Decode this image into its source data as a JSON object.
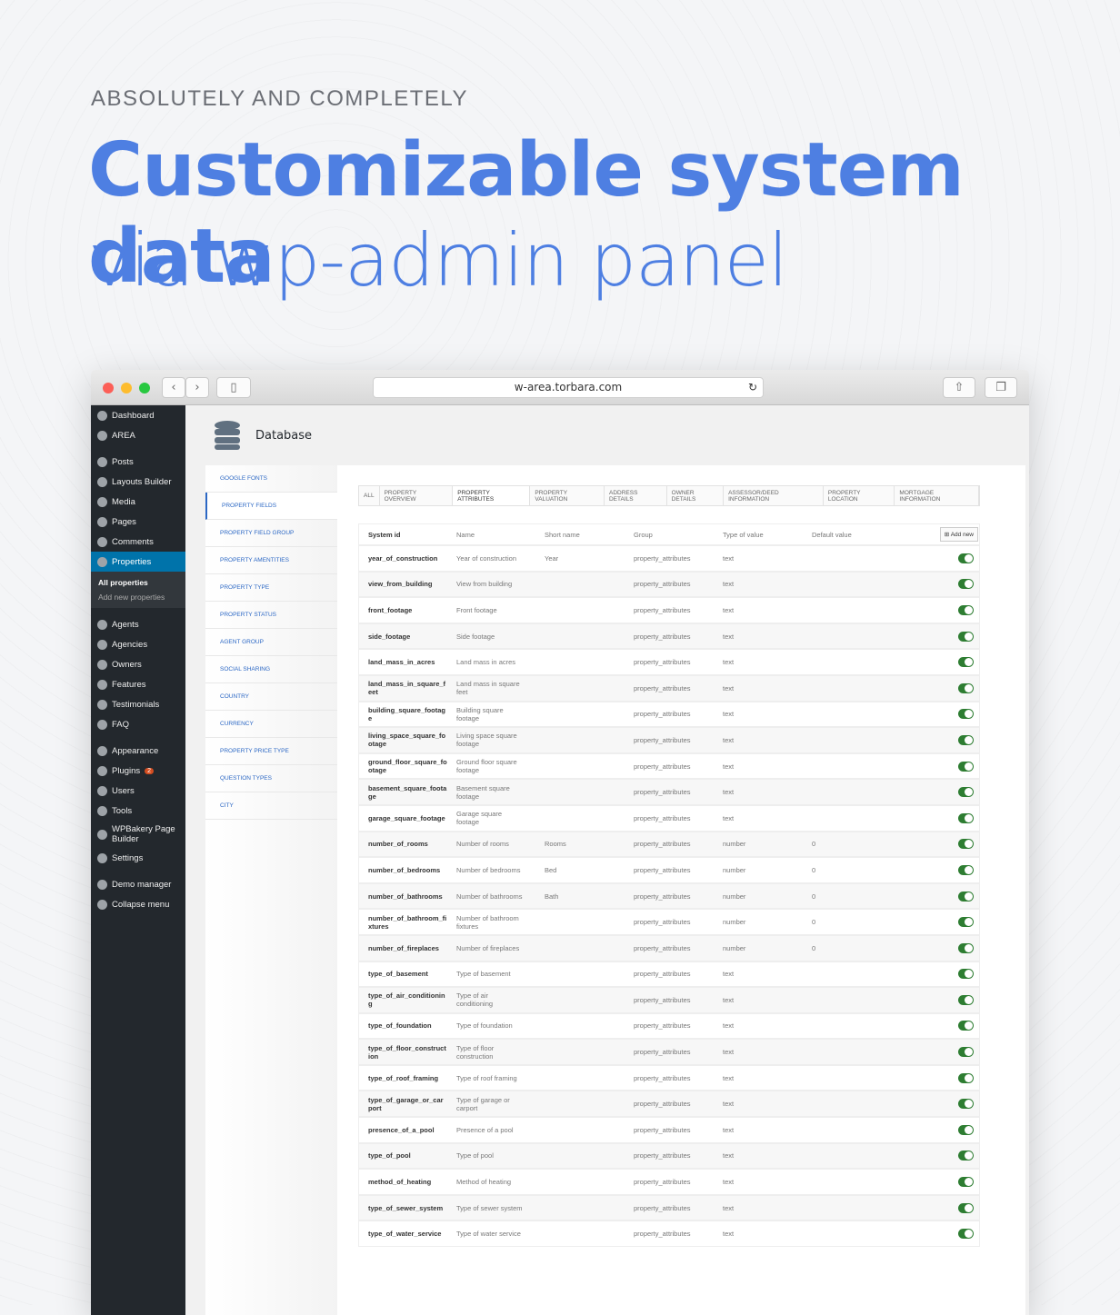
{
  "hero": {
    "kicker": "ABSOLUTELY AND COMPLETELY",
    "title": "Customizable system data",
    "subtitle": "via wp-admin panel",
    "accent": "#4e7fe2"
  },
  "browser": {
    "url": "w-area.torbara.com"
  },
  "sidebar": {
    "items": [
      {
        "label": "Dashboard"
      },
      {
        "label": "AREA"
      },
      {
        "label": "Posts"
      },
      {
        "label": "Layouts Builder"
      },
      {
        "label": "Media"
      },
      {
        "label": "Pages"
      },
      {
        "label": "Comments"
      },
      {
        "label": "Properties",
        "active": true
      },
      {
        "label": "Agents"
      },
      {
        "label": "Agencies"
      },
      {
        "label": "Owners"
      },
      {
        "label": "Features"
      },
      {
        "label": "Testimonials"
      },
      {
        "label": "FAQ"
      },
      {
        "label": "Appearance"
      },
      {
        "label": "Plugins",
        "badge": "2"
      },
      {
        "label": "Users"
      },
      {
        "label": "Tools"
      },
      {
        "label": "WPBakery Page Builder"
      },
      {
        "label": "Settings"
      },
      {
        "label": "Demo manager"
      },
      {
        "label": "Collapse menu"
      }
    ],
    "submenu": [
      "All properties",
      "Add new properties"
    ]
  },
  "page": {
    "title": "Database"
  },
  "left_tabs": [
    "GOOGLE FONTS",
    "PROPERTY FIELDS",
    "PROPERTY FIELD GROUP",
    "PROPERTY AMENTITIES",
    "PROPERTY TYPE",
    "PROPERTY STATUS",
    "AGENT GROUP",
    "SOCIAL SHARING",
    "COUNTRY",
    "CURRENCY",
    "PROPERTY PRICE TYPE",
    "QUESTION TYPES",
    "CITY"
  ],
  "left_active": 1,
  "group_tabs": [
    "ALL",
    "PROPERTY OVERVIEW",
    "PROPERTY ATTRIBUTES",
    "PROPERTY VALUATION",
    "ADDRESS DETAILS",
    "OWNER DETAILS",
    "ASSESSOR/DEED INFORMATION",
    "PROPERTY LOCATION",
    "MORTGAGE INFORMATION"
  ],
  "group_active": 2,
  "table": {
    "headers": [
      "System id",
      "Name",
      "Short name",
      "Group",
      "Type of value",
      "Default value"
    ],
    "add_label": "Add new",
    "toggle_color": "#2e7d32",
    "rows": [
      [
        "year_of_construction",
        "Year of construction",
        "Year",
        "property_attributes",
        "text",
        ""
      ],
      [
        "view_from_building",
        "View from building",
        "",
        "property_attributes",
        "text",
        ""
      ],
      [
        "front_footage",
        "Front footage",
        "",
        "property_attributes",
        "text",
        ""
      ],
      [
        "side_footage",
        "Side footage",
        "",
        "property_attributes",
        "text",
        ""
      ],
      [
        "land_mass_in_acres",
        "Land mass in acres",
        "",
        "property_attributes",
        "text",
        ""
      ],
      [
        "land_mass_in_square_feet",
        "Land mass in square feet",
        "",
        "property_attributes",
        "text",
        ""
      ],
      [
        "building_square_footage",
        "Building square footage",
        "",
        "property_attributes",
        "text",
        ""
      ],
      [
        "living_space_square_footage",
        "Living space square footage",
        "",
        "property_attributes",
        "text",
        ""
      ],
      [
        "ground_floor_square_footage",
        "Ground floor square footage",
        "",
        "property_attributes",
        "text",
        ""
      ],
      [
        "basement_square_footage",
        "Basement square footage",
        "",
        "property_attributes",
        "text",
        ""
      ],
      [
        "garage_square_footage",
        "Garage square footage",
        "",
        "property_attributes",
        "text",
        ""
      ],
      [
        "number_of_rooms",
        "Number of rooms",
        "Rooms",
        "property_attributes",
        "number",
        "0"
      ],
      [
        "number_of_bedrooms",
        "Number of bedrooms",
        "Bed",
        "property_attributes",
        "number",
        "0"
      ],
      [
        "number_of_bathrooms",
        "Number of bathrooms",
        "Bath",
        "property_attributes",
        "number",
        "0"
      ],
      [
        "number_of_bathroom_fixtures",
        "Number of bathroom fixtures",
        "",
        "property_attributes",
        "number",
        "0"
      ],
      [
        "number_of_fireplaces",
        "Number of fireplaces",
        "",
        "property_attributes",
        "number",
        "0"
      ],
      [
        "type_of_basement",
        "Type of basement",
        "",
        "property_attributes",
        "text",
        ""
      ],
      [
        "type_of_air_conditioning",
        "Type of air conditioning",
        "",
        "property_attributes",
        "text",
        ""
      ],
      [
        "type_of_foundation",
        "Type of foundation",
        "",
        "property_attributes",
        "text",
        ""
      ],
      [
        "type_of_floor_construction",
        "Type of floor construction",
        "",
        "property_attributes",
        "text",
        ""
      ],
      [
        "type_of_roof_framing",
        "Type of roof framing",
        "",
        "property_attributes",
        "text",
        ""
      ],
      [
        "type_of_garage_or_carport",
        "Type of garage or carport",
        "",
        "property_attributes",
        "text",
        ""
      ],
      [
        "presence_of_a_pool",
        "Presence of a pool",
        "",
        "property_attributes",
        "text",
        ""
      ],
      [
        "type_of_pool",
        "Type of pool",
        "",
        "property_attributes",
        "text",
        ""
      ],
      [
        "method_of_heating",
        "Method of heating",
        "",
        "property_attributes",
        "text",
        ""
      ],
      [
        "type_of_sewer_system",
        "Type of sewer system",
        "",
        "property_attributes",
        "text",
        ""
      ],
      [
        "type_of_water_service",
        "Type of water service",
        "",
        "property_attributes",
        "text",
        ""
      ]
    ]
  }
}
